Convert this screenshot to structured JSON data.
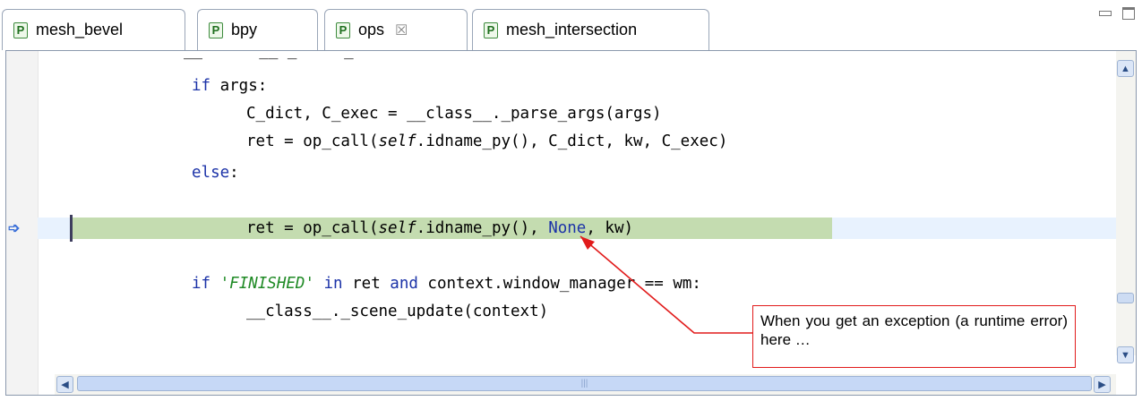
{
  "tabs": [
    {
      "label": "mesh_bevel",
      "icon": "python-file-icon",
      "letter": "P"
    },
    {
      "label": "bpy",
      "icon": "python-file-icon",
      "letter": "P"
    },
    {
      "label": "ops",
      "icon": "python-file-icon",
      "letter": "P",
      "active": true,
      "close": "☒"
    },
    {
      "label": "mesh_intersection",
      "icon": "python-file-icon",
      "letter": "P"
    }
  ],
  "code": {
    "lines": [
      {
        "t": "if args:"
      },
      {
        "t": "C_dict, C_exec = __class__._parse_args(args)"
      },
      {
        "t": "ret = op_call(self.idname_py(), C_dict, kw, C_exec)"
      },
      {
        "t": "else:"
      },
      {
        "t": "ret = op_call(self.idname_py(), None, kw)"
      },
      {
        "t": "if 'FINISHED' in ret and context.window_manager == wm:"
      },
      {
        "t": "__class__._scene_update(context)"
      }
    ]
  },
  "tokens": {
    "if": "if",
    "args": " args:",
    "l2": "C_dict, C_exec = __class__._parse_args(args)",
    "l3a": "ret = op_call(",
    "self": "self",
    "l3b": ".idname_py(), C_dict, kw, C_exec)",
    "else": "else",
    "colon": ":",
    "l5a": "ret = op_call(",
    "l5b": ".idname_py(), ",
    "none": "None",
    "l5c": ", kw)",
    "finished": "'FINISHED'",
    "in": " in",
    "ret": " ret ",
    "and": "and",
    "l6b": " context.window_manager == wm:",
    "l7": "__class__._scene_update(context)"
  },
  "annotation": {
    "text": "When you get an exception (a runtime error) here …",
    "color": "#e11b1b"
  },
  "colors": {
    "keyword": "#1c33a8",
    "string": "#1f8a25",
    "current_line": "#c4dcb0",
    "annotation": "#e11b1b"
  }
}
